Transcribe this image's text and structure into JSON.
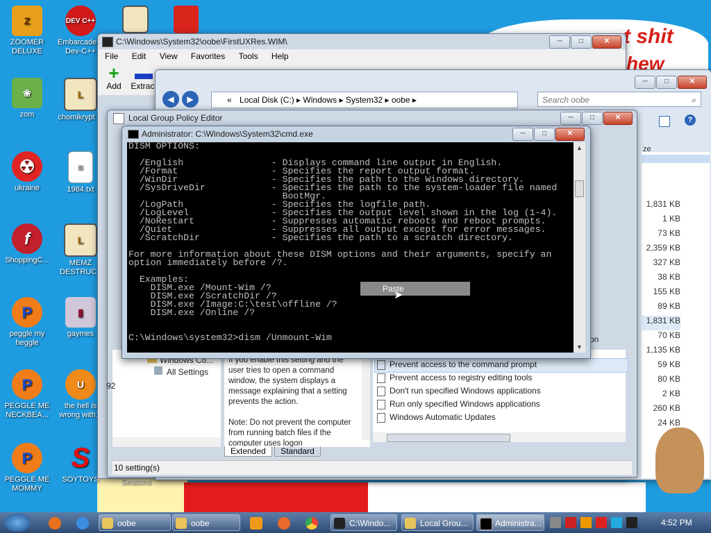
{
  "desktop": {
    "icons": [
      {
        "label": "ZOOMER DELUXE",
        "glyph": "Z"
      },
      {
        "label": "Embarcadero Dev-C++",
        "glyph": "DEV C++"
      },
      {
        "label": "zom",
        "glyph": "❀"
      },
      {
        "label": "chomikrypt",
        "glyph": "L"
      },
      {
        "label": "ukraine",
        "glyph": "☢"
      },
      {
        "label": "1984.txt",
        "glyph": "≡"
      },
      {
        "label": "ShoppingC...",
        "glyph": "f"
      },
      {
        "label": "MEMZ DESTRUCT",
        "glyph": "L"
      },
      {
        "label": "peggle my heggle",
        "glyph": "P"
      },
      {
        "label": "gaymes",
        "glyph": "▮"
      },
      {
        "label": "PEGGLE ME NECKBEA...",
        "glyph": "P"
      },
      {
        "label": "the hell is wrong with...",
        "glyph": "U"
      },
      {
        "label": "PEGGLE ME MOMMY",
        "glyph": "P"
      },
      {
        "label": "SOYTOYS",
        "glyph": "S"
      },
      {
        "label": "Angry Birds Seasons",
        "glyph": ""
      }
    ],
    "background_text": [
      "t shit",
      "hew"
    ]
  },
  "window_wim": {
    "title": "C:\\Windows\\System32\\oobe\\FirstUXRes.WIM\\",
    "menu": [
      "File",
      "Edit",
      "View",
      "Favorites",
      "Tools",
      "Help"
    ],
    "toolbar": {
      "add": "Add",
      "extract": "Extract"
    }
  },
  "window_explorer": {
    "breadcrumb": [
      "«",
      "Local Disk (C:)",
      "Windows",
      "System32",
      "oobe"
    ],
    "search_placeholder": "Search oobe",
    "sizes": [
      "1,831 KB",
      "1 KB",
      "73 KB",
      "2,359 KB",
      "327 KB",
      "38 KB",
      "155 KB",
      "89 KB",
      "1,831 KB",
      "70 KB",
      "1,135 KB",
      "59 KB",
      "80 KB",
      "2 KB",
      "260 KB",
      "24 KB"
    ],
    "partial_col": "ze",
    "partial_on": "on"
  },
  "window_gpedit": {
    "title": "Local Group Policy Editor",
    "tree": [
      "Windows Co...",
      "All Settings"
    ],
    "description": "If you enable this setting and the user tries to open a command window, the system displays a message explaining that a setting prevents the action.",
    "note": "Note: Do not prevent the computer from running batch files if the computer uses logon",
    "settings": [
      "Prevent access to the command prompt",
      "Prevent access to registry editing tools",
      "Don't run specified Windows applications",
      "Run only specified Windows applications",
      "Windows Automatic Updates"
    ],
    "tabs": [
      "Extended",
      "Standard"
    ],
    "status": "10 setting(s)",
    "left_status": "92"
  },
  "cmd": {
    "title": "Administrator: C:\\Windows\\System32\\cmd.exe",
    "lines": [
      "DISM OPTIONS:",
      "",
      "  /English                - Displays command line output in English.",
      "  /Format                 - Specifies the report output format.",
      "  /WinDir                 - Specifies the path to the Windows directory.",
      "  /SysDriveDir            - Specifies the path to the system-loader file named",
      "                            BootMgr.",
      "  /LogPath                - Specifies the logfile path.",
      "  /LogLevel               - Specifies the output level shown in the log (1-4).",
      "  /NoRestart              - Suppresses automatic reboots and reboot prompts.",
      "  /Quiet                  - Suppresses all output except for error messages.",
      "  /ScratchDir             - Specifies the path to a scratch directory.",
      "",
      "For more information about these DISM options and their arguments, specify an",
      "option immediately before /?.",
      "",
      "  Examples:",
      "    DISM.exe /Mount-Wim /?",
      "    DISM.exe /ScratchDir /?",
      "    DISM.exe /Image:C:\\test\\offline /?",
      "    DISM.exe /Online /?",
      "",
      "",
      "C:\\Windows\\system32>dism /Unmount-Wim"
    ],
    "context_menu": "Paste"
  },
  "taskbar": {
    "items": [
      "oobe",
      "oobe",
      "C:\\Windo...",
      "Local Grou...",
      "Administra..."
    ],
    "clock": "4:52 PM"
  }
}
